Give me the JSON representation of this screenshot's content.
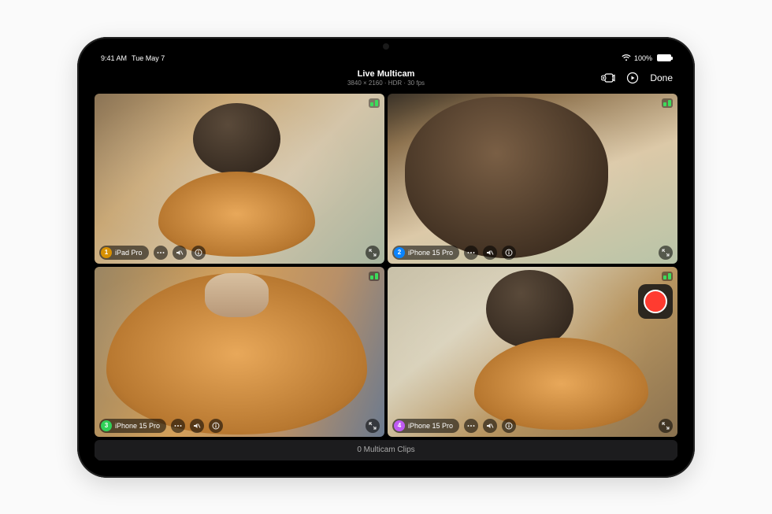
{
  "statusbar": {
    "time": "9:41 AM",
    "date": "Tue May 7",
    "battery": "100%"
  },
  "header": {
    "title": "Live Multicam",
    "subtitle": "3840 × 2160 · HDR · 30 fps",
    "done_label": "Done"
  },
  "cameras": [
    {
      "index": "1",
      "label": "iPad Pro"
    },
    {
      "index": "2",
      "label": "iPhone 15 Pro"
    },
    {
      "index": "3",
      "label": "iPhone 15 Pro"
    },
    {
      "index": "4",
      "label": "iPhone 15 Pro"
    }
  ],
  "footer": {
    "clips_label": "0 Multicam Clips"
  }
}
